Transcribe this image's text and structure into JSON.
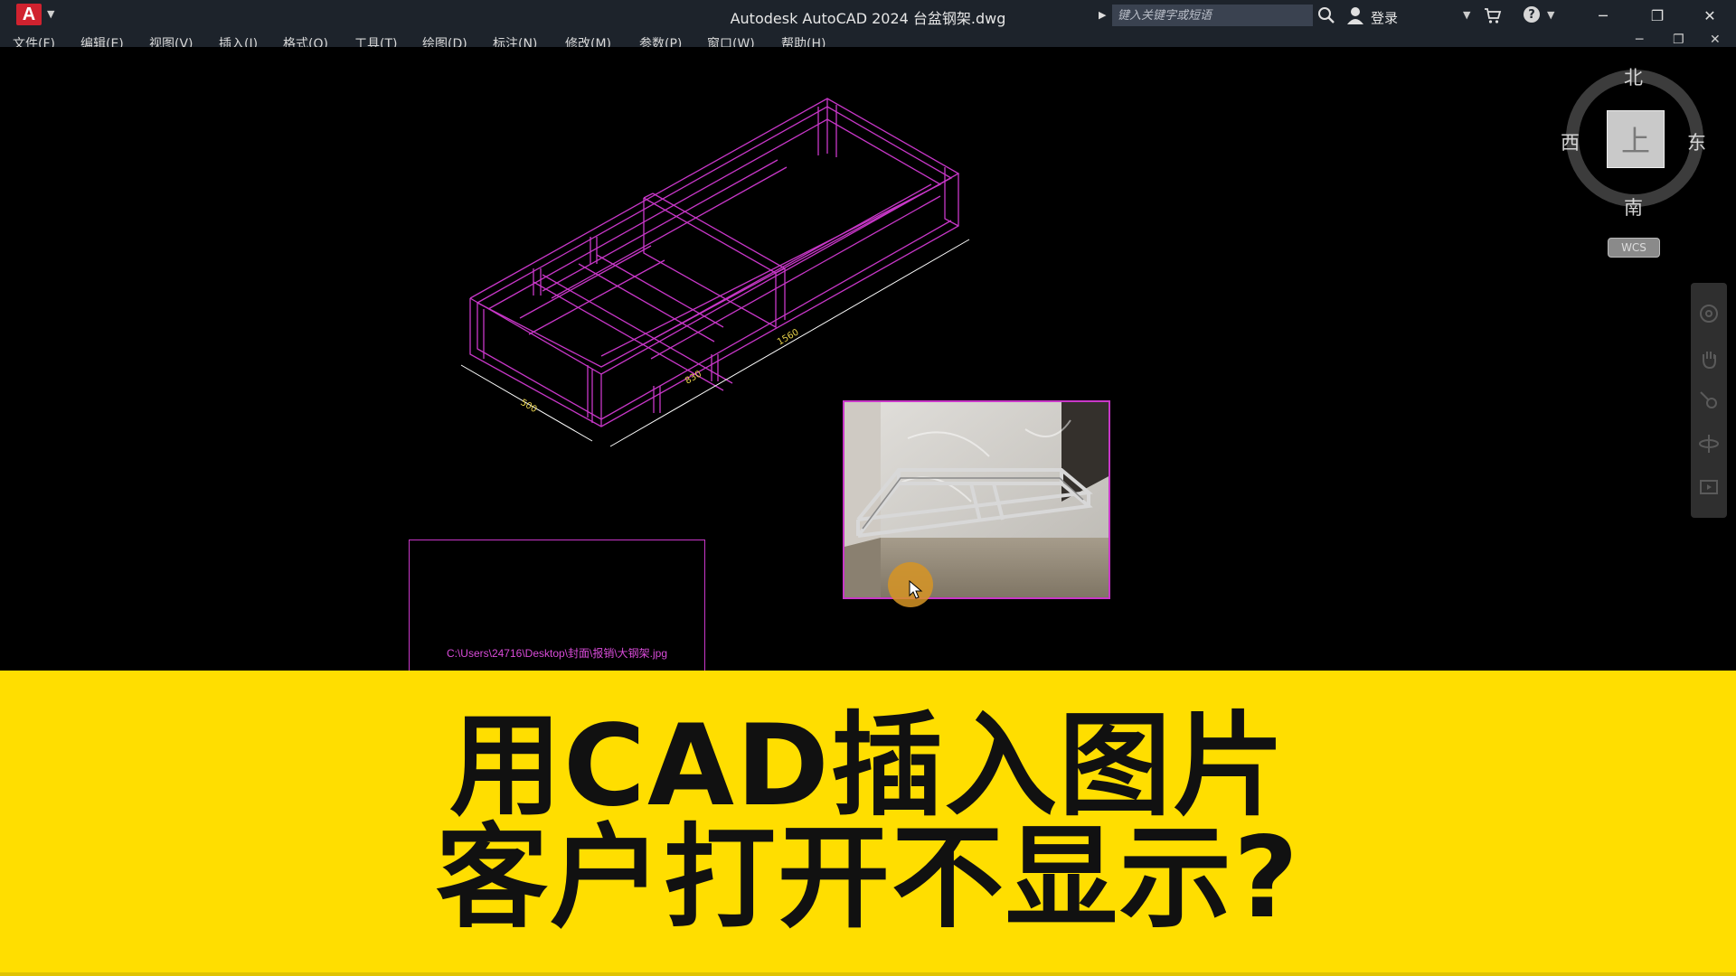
{
  "titlebar": {
    "app_logo": "A",
    "window_title": "Autodesk AutoCAD 2024   台盆钢架.dwg",
    "search_placeholder": "键入关键字或短语",
    "login_label": "登录",
    "icons": [
      "search-icon",
      "user-icon",
      "cart-icon",
      "help-icon",
      "minimize-icon",
      "restore-icon",
      "close-icon"
    ]
  },
  "menubar": {
    "items": [
      "文件(F)",
      "编辑(E)",
      "视图(V)",
      "插入(I)",
      "格式(O)",
      "工具(T)",
      "绘图(D)",
      "标注(N)",
      "修改(M)",
      "参数(P)",
      "窗口(W)",
      "帮助(H)"
    ]
  },
  "drawing": {
    "dimensions": [
      "500",
      "830",
      "1560"
    ],
    "line_color": "#c837c8",
    "dimension_color": "#e8d24a"
  },
  "image_frame": {
    "path_text": "C:\\Users\\24716\\Desktop\\封面\\报销\\大钢架.jpg"
  },
  "viewcube": {
    "north": "北",
    "south": "南",
    "west": "西",
    "east": "东",
    "face": "上",
    "wcs": "WCS"
  },
  "caption": {
    "line1": "用CAD插入图片",
    "line2": "客户打开不显示?"
  },
  "colors": {
    "banner": "#ffde00",
    "titlebar": "#1d232b",
    "accent": "#d0222f"
  }
}
